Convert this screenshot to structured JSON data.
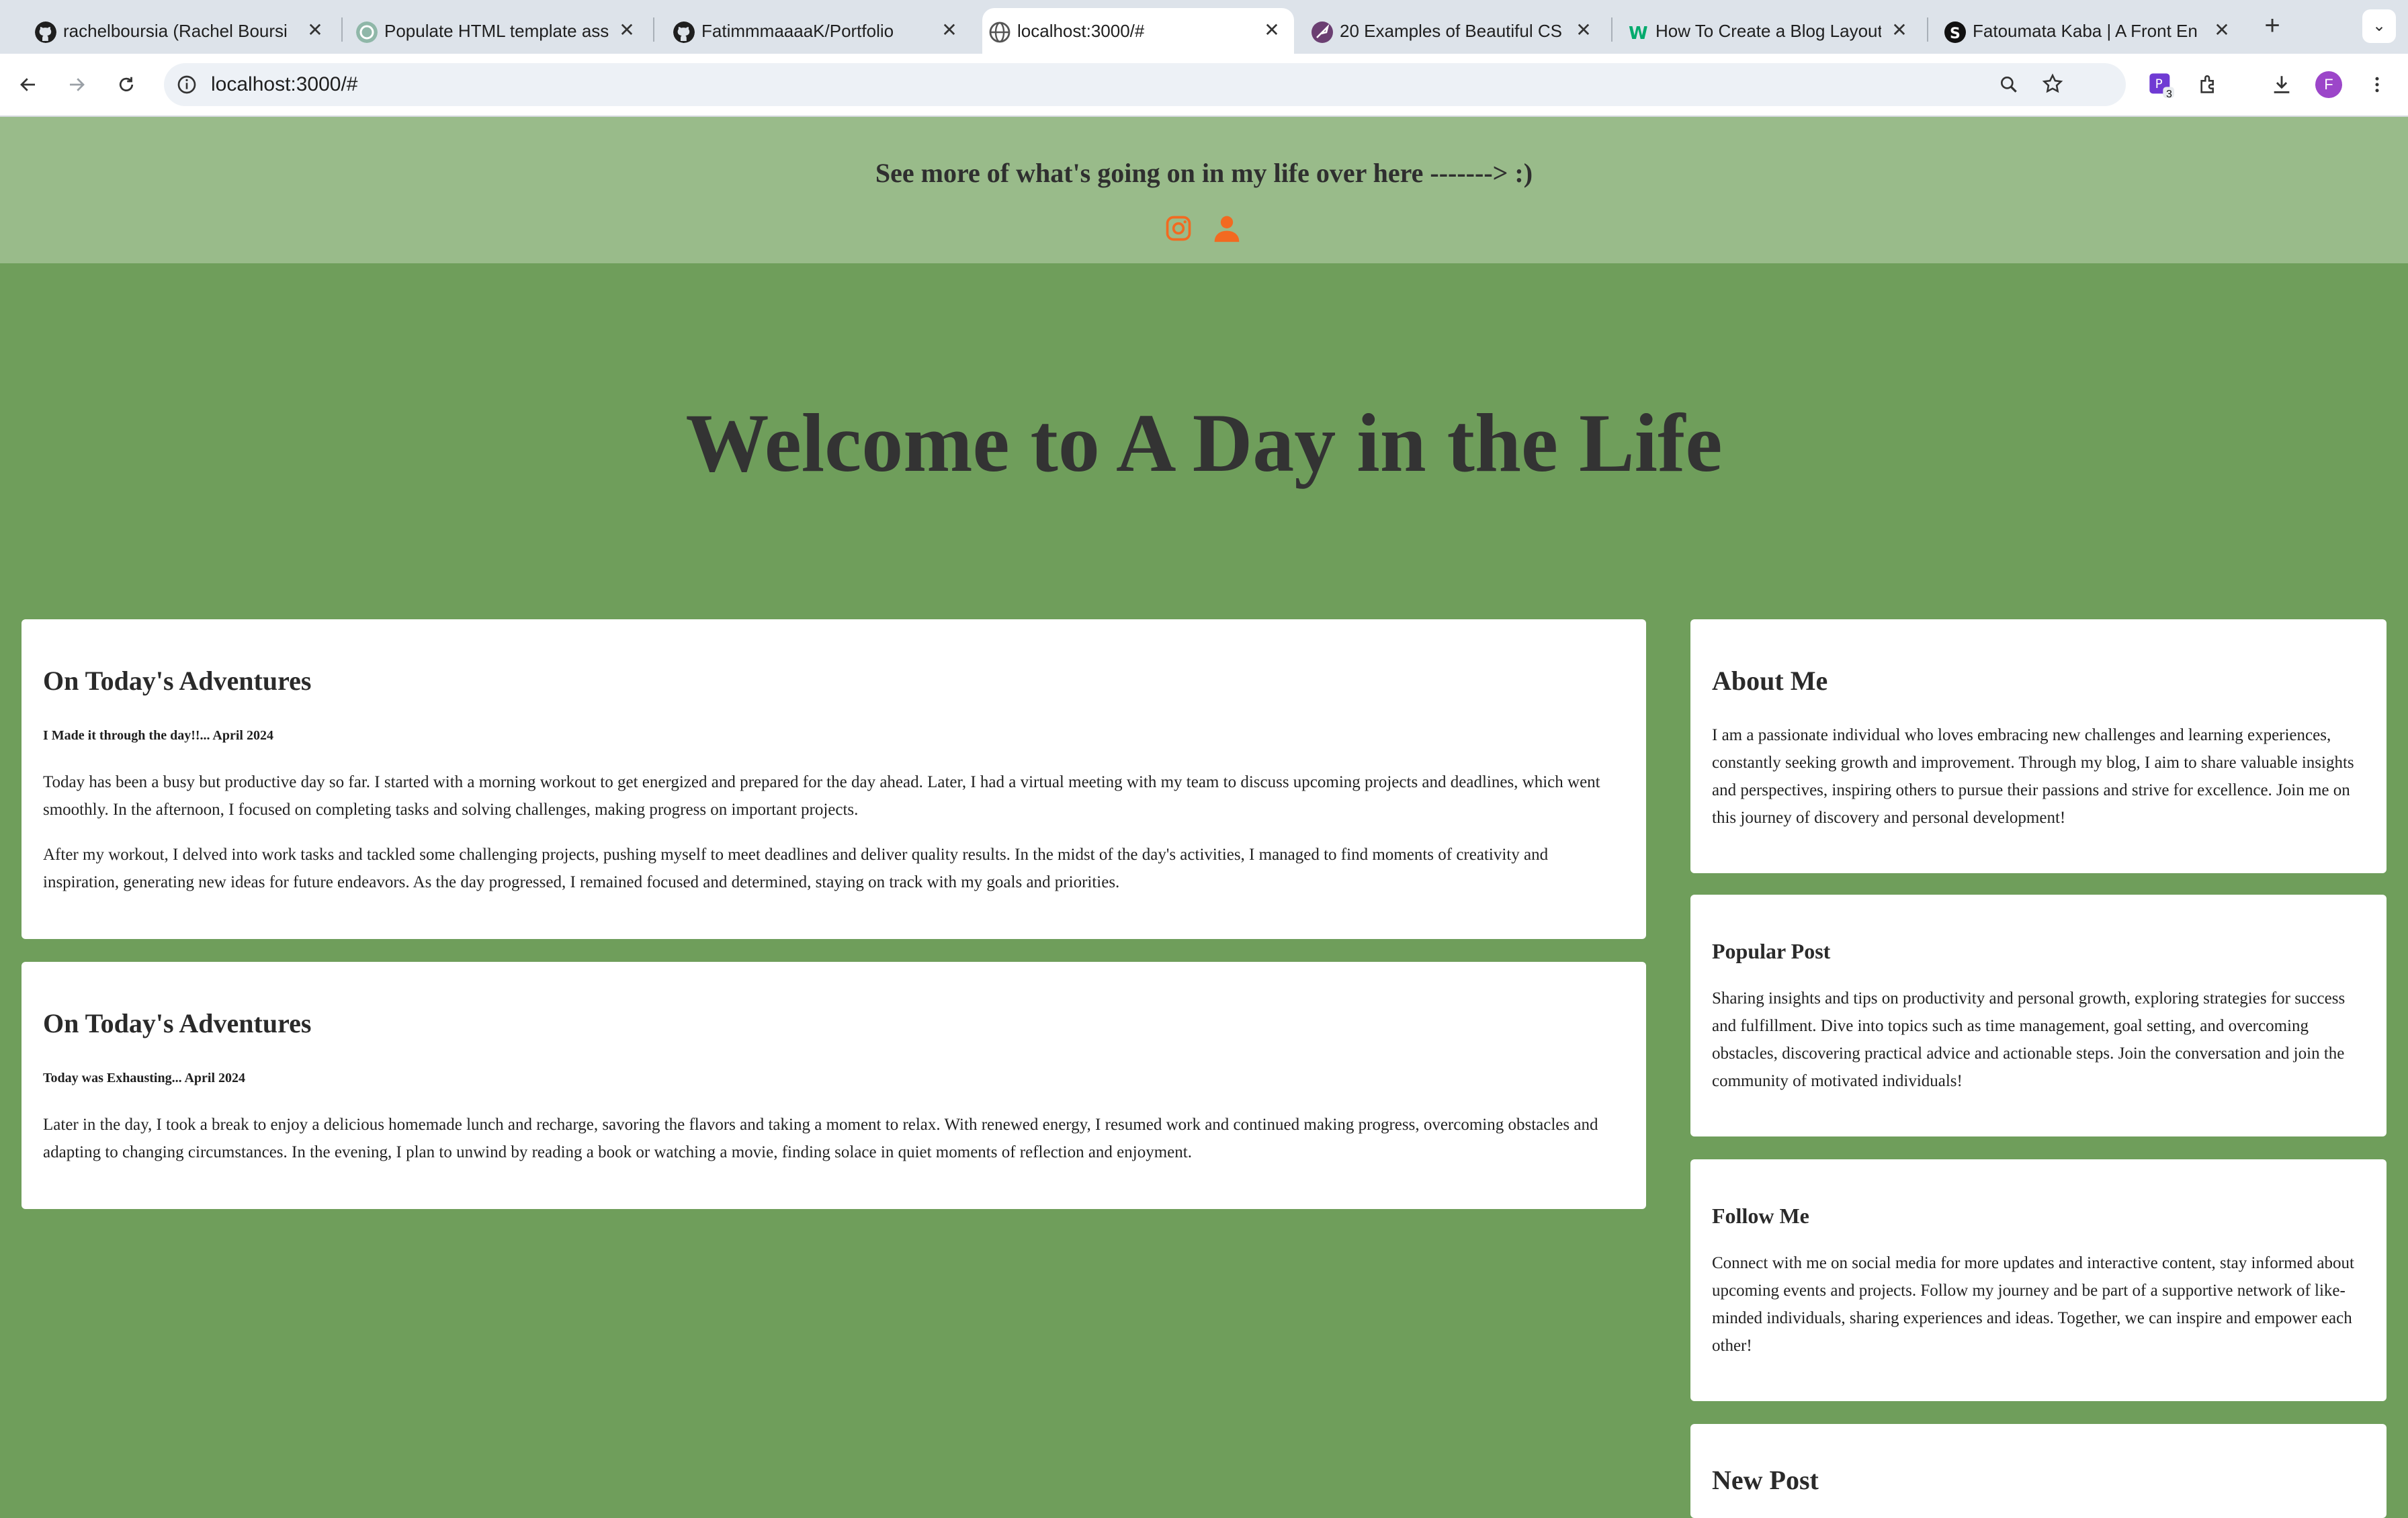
{
  "browser": {
    "tabs": [
      {
        "title": "rachelboursia (Rachel Boursi",
        "favicon": "github-icon"
      },
      {
        "title": "Populate HTML template ass",
        "favicon": "chatgpt-icon"
      },
      {
        "title": "FatimmmaaaaK/Portfolio",
        "favicon": "github-icon"
      },
      {
        "title": "localhost:3000/#",
        "favicon": "globe-icon",
        "active": true
      },
      {
        "title": "20 Examples of Beautiful CS",
        "favicon": "rocket-icon"
      },
      {
        "title": "How To Create a Blog Layout",
        "favicon": "w3schools-icon"
      },
      {
        "title": "Fatoumata Kaba | A Front En",
        "favicon": "squarespace-icon"
      }
    ],
    "url": "localhost:3000/#",
    "extension_badge": "3",
    "profile_initial": "F"
  },
  "banner": {
    "message": "See more of what's going on in my life over here -------> :)"
  },
  "hero": {
    "title": "Welcome to A Day in the Life"
  },
  "posts": [
    {
      "heading": "On Today's Adventures",
      "subtitle": "I Made it through the day!!... April 2024",
      "paragraphs": [
        "Today has been a busy but productive day so far. I started with a morning workout to get energized and prepared for the day ahead. Later, I had a virtual meeting with my team to discuss upcoming projects and deadlines, which went smoothly. In the afternoon, I focused on completing tasks and solving challenges, making progress on important projects.",
        "After my workout, I delved into work tasks and tackled some challenging projects, pushing myself to meet deadlines and deliver quality results. In the midst of the day's activities, I managed to find moments of creativity and inspiration, generating new ideas for future endeavors. As the day progressed, I remained focused and determined, staying on track with my goals and priorities."
      ]
    },
    {
      "heading": "On Today's Adventures",
      "subtitle": "Today was Exhausting... April 2024",
      "paragraphs": [
        "Later in the day, I took a break to enjoy a delicious homemade lunch and recharge, savoring the flavors and taking a moment to relax. With renewed energy, I resumed work and continued making progress, overcoming obstacles and adapting to changing circumstances. In the evening, I plan to unwind by reading a book or watching a movie, finding solace in quiet moments of reflection and enjoyment."
      ]
    }
  ],
  "sidebar": {
    "about": {
      "heading": "About Me",
      "text": "I am a passionate individual who loves embracing new challenges and learning experiences, constantly seeking growth and improvement. Through my blog, I aim to share valuable insights and perspectives, inspiring others to pursue their passions and strive for excellence. Join me on this journey of discovery and personal development!"
    },
    "popular": {
      "heading": "Popular Post",
      "text": "Sharing insights and tips on productivity and personal growth, exploring strategies for success and fulfillment. Dive into topics such as time management, goal setting, and overcoming obstacles, discovering practical advice and actionable steps. Join the conversation and join the community of motivated individuals!"
    },
    "follow": {
      "heading": "Follow Me",
      "text": "Connect with me on social media for more updates and interactive content, stay informed about upcoming events and projects. Follow my journey and be part of a supportive network of like-minded individuals, sharing experiences and ideas. Together, we can inspire and empower each other!"
    },
    "new_post": {
      "heading": "New Post"
    }
  },
  "colors": {
    "page_bg": "#6f9e5b",
    "banner_bg": "#99bb8a",
    "icon_accent": "#f26a21",
    "card_bg": "#ffffff"
  }
}
